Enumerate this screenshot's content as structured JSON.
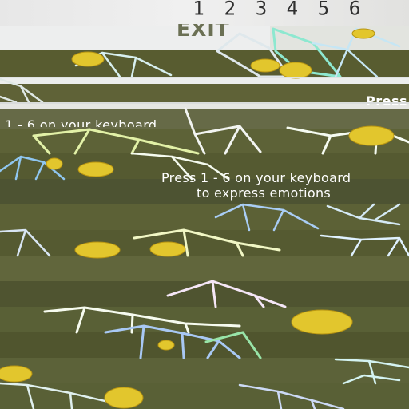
{
  "hud": {
    "emotion_keys": [
      "1",
      "2",
      "3",
      "4",
      "5",
      "6"
    ],
    "exit_label": "EXIT"
  },
  "instructions": {
    "fragment_right": "Press",
    "fragment_left": "1 - 6 on your keyboard",
    "center_line_1": "Press 1 - 6 on your keyboard",
    "center_line_2": "to express emotions"
  },
  "scene": {
    "colors": {
      "panel_light": "#edeeee",
      "ground_olive": "#596036",
      "flower_yellow": "#e1c72b",
      "lattice_blue": "#7fb8e7",
      "lattice_green": "#8fe09e",
      "lattice_white": "#eef3f0"
    }
  }
}
